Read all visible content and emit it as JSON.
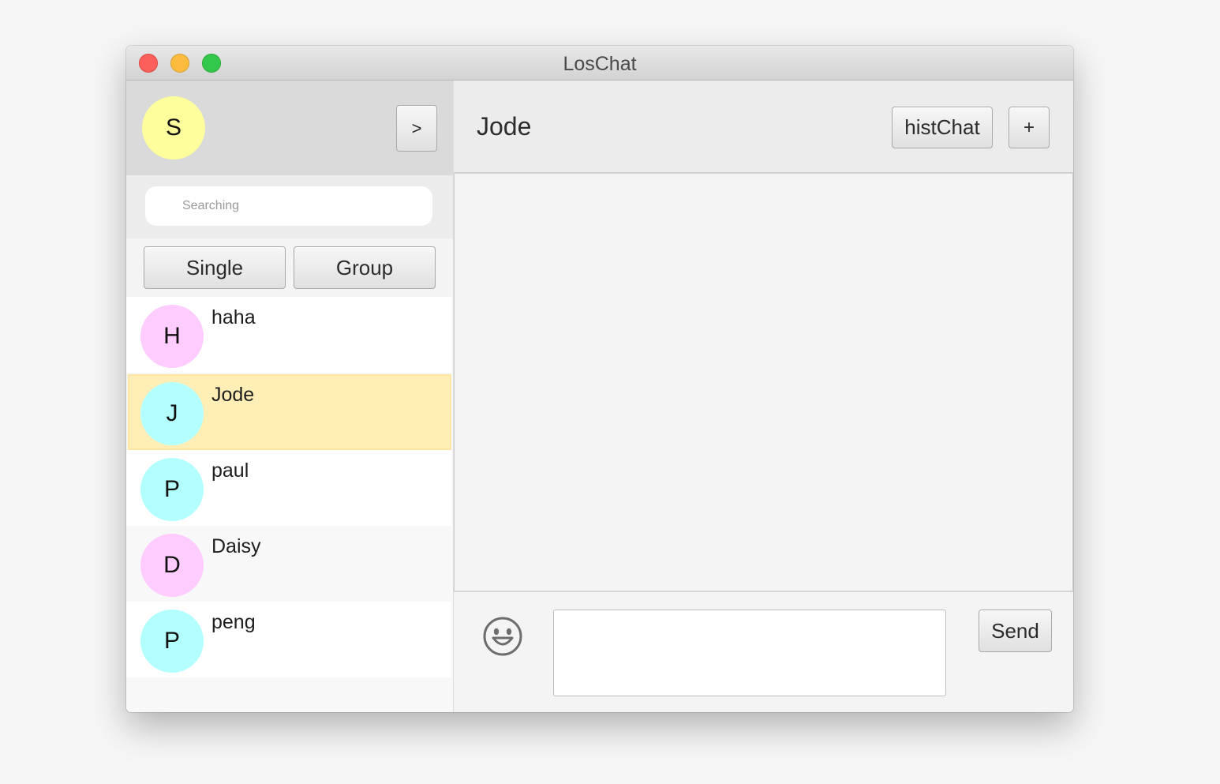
{
  "window": {
    "title": "LosChat"
  },
  "profile": {
    "avatar_letter": "S",
    "avatar_color": "#fffe9c",
    "expand_label": ">"
  },
  "search": {
    "placeholder": "Searching",
    "value": ""
  },
  "filters": {
    "single_label": "Single",
    "group_label": "Group"
  },
  "contacts": [
    {
      "letter": "H",
      "name": "haha",
      "color": "#ffccff",
      "selected": false,
      "bg": "#ffffff"
    },
    {
      "letter": "J",
      "name": "Jode",
      "color": "#b3ffff",
      "selected": true,
      "bg": "#ffeeb5"
    },
    {
      "letter": "P",
      "name": "paul",
      "color": "#b3ffff",
      "selected": false,
      "bg": "#ffffff"
    },
    {
      "letter": "D",
      "name": "Daisy",
      "color": "#ffccff",
      "selected": false,
      "bg": "#f8f8f8"
    },
    {
      "letter": "P",
      "name": "peng",
      "color": "#b3ffff",
      "selected": false,
      "bg": "#ffffff"
    }
  ],
  "chat": {
    "title": "Jode",
    "hist_label": "histChat",
    "add_label": "+",
    "send_label": "Send",
    "message_value": ""
  },
  "icons": {
    "emoji": "smiley-face-icon"
  }
}
